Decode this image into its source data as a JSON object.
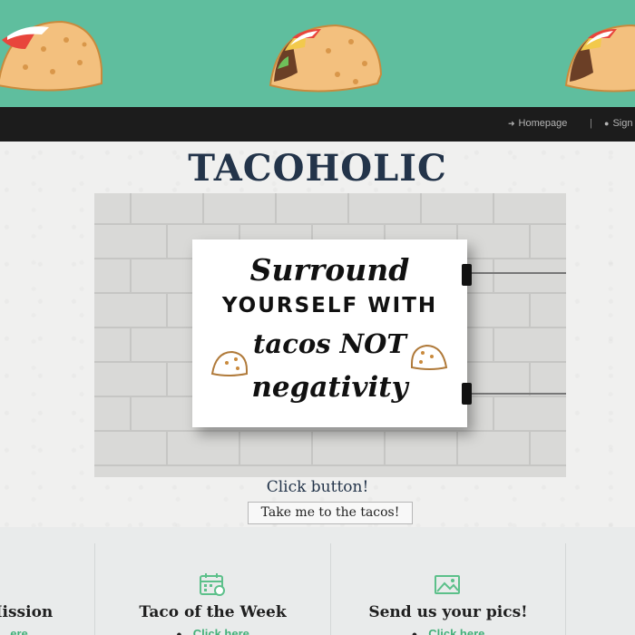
{
  "nav": {
    "homepage": "Homepage",
    "separator": "|",
    "signin": "Sign"
  },
  "main": {
    "title": "TACOHOLIC",
    "poster": {
      "line1": "Surround",
      "line2": "YOURSELF WITH",
      "line3": "tacos NOT",
      "line4": "negativity"
    },
    "click_label": "Click button!",
    "button_label": "Take me to the tacos!"
  },
  "cards": [
    {
      "title": "Mission",
      "link": "ere",
      "icon": "none"
    },
    {
      "title": "Taco of the Week",
      "link": "Click here",
      "icon": "calendar-icon"
    },
    {
      "title": "Send us your pics!",
      "link": "Click here",
      "icon": "image-icon"
    }
  ],
  "colors": {
    "banner": "#5fbe9e",
    "navbar": "#1c1c1c",
    "title": "#23344a",
    "link": "#44b07a"
  }
}
